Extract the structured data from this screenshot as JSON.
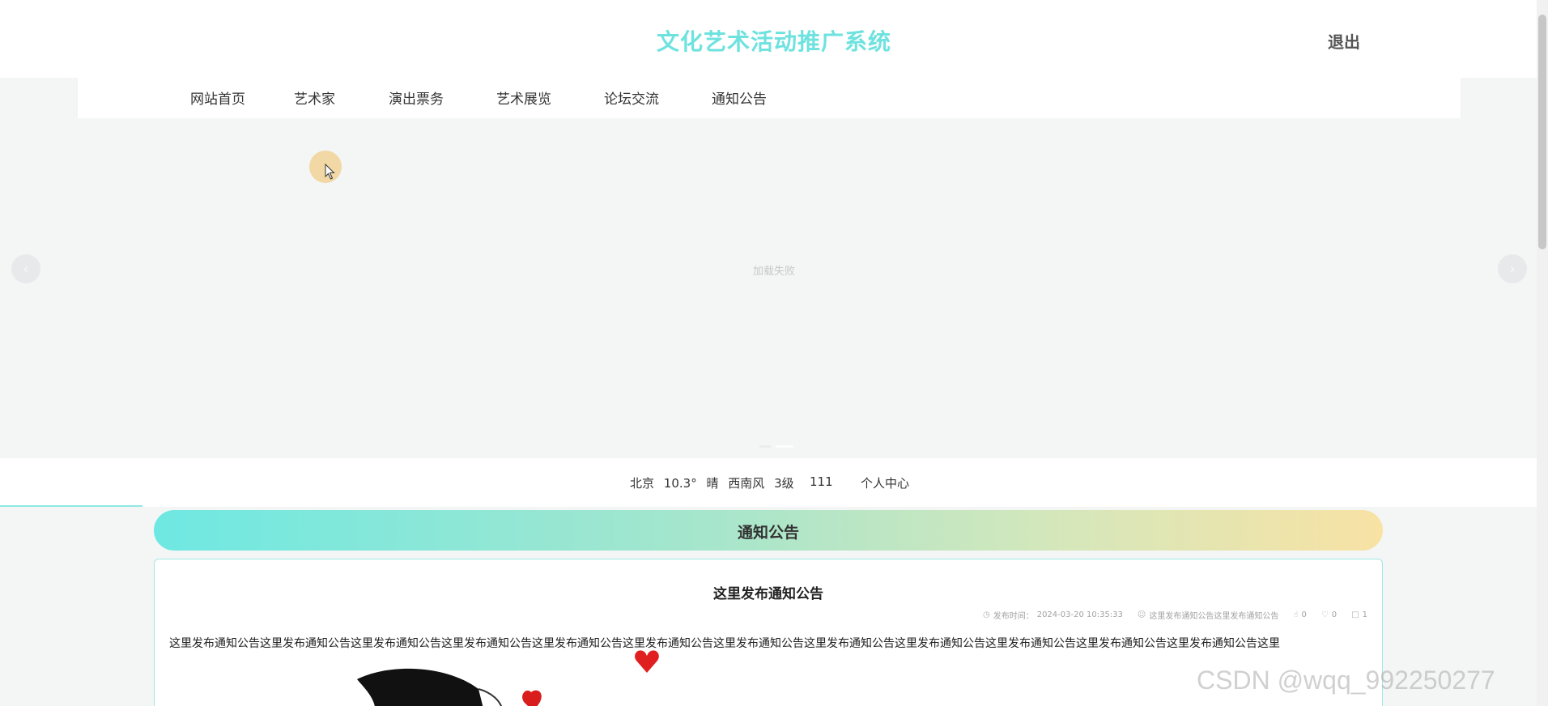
{
  "header": {
    "title": "文化艺术活动推广系统",
    "logout_label": "退出",
    "title_color": "#6ee2df"
  },
  "nav": {
    "items": [
      {
        "label": "网站首页"
      },
      {
        "label": "艺术家"
      },
      {
        "label": "演出票务"
      },
      {
        "label": "艺术展览"
      },
      {
        "label": "论坛交流"
      },
      {
        "label": "通知公告"
      }
    ]
  },
  "carousel": {
    "load_failed_text": "加载失败",
    "prev_icon": "chevron-left-icon",
    "next_icon": "chevron-right-icon",
    "slides": 2,
    "active_slide": 2
  },
  "info_bar": {
    "weather": {
      "city": "北京",
      "temperature": "10.3°",
      "condition": "晴",
      "wind": "西南风",
      "level": "3级"
    },
    "number": "111",
    "personal_center_label": "个人中心"
  },
  "notice_section": {
    "title": "通知公告",
    "gradient_colors": [
      "#6ee8e2",
      "#f8e2a4"
    ],
    "item": {
      "title": "这里发布通知公告",
      "publish_label": "发布时间：",
      "publish_time": "2024-03-20 10:35:33",
      "author": "这里发布通知公告这里发布通知公告",
      "likes": "0",
      "favorites": "0",
      "comments": "1",
      "body": "这里发布通知公告这里发布通知公告这里发布通知公告这里发布通知公告这里发布通知公告这里发布通知公告这里发布通知公告这里发布通知公告这里发布通知公告这里发布通知公告这里发布通知公告这里发布通知公告这里"
    }
  },
  "watermark": "CSDN @wqq_992250277"
}
